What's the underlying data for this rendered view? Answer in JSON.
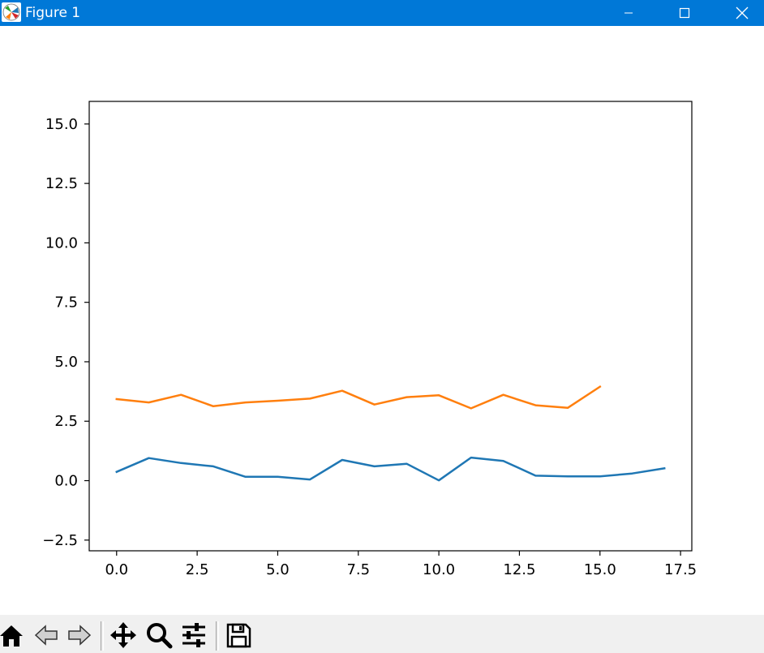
{
  "window": {
    "title": "Figure 1",
    "icon": "matplotlib-figure-icon",
    "controls": [
      "minimize-icon",
      "maximize-icon",
      "close-icon"
    ]
  },
  "toolbar": {
    "tools": [
      {
        "name": "home-button",
        "icon": "home-icon"
      },
      {
        "name": "back-button",
        "icon": "back-arrow-icon"
      },
      {
        "name": "forward-button",
        "icon": "forward-arrow-icon"
      },
      {
        "name": "pan-button",
        "icon": "move-icon"
      },
      {
        "name": "zoom-button",
        "icon": "zoom-icon"
      },
      {
        "name": "configure-subplots-button",
        "icon": "sliders-icon"
      },
      {
        "name": "save-button",
        "icon": "save-icon"
      }
    ]
  },
  "chart_data": {
    "type": "line",
    "title": "",
    "xlabel": "",
    "ylabel": "",
    "xlim": [
      -0.85,
      17.85
    ],
    "ylim": [
      -2.95,
      15.95
    ],
    "xticks": [
      "0.0",
      "2.5",
      "5.0",
      "7.5",
      "10.0",
      "12.5",
      "15.0",
      "17.5"
    ],
    "xtick_values": [
      0,
      2.5,
      5,
      7.5,
      10,
      12.5,
      15,
      17.5
    ],
    "yticks": [
      "−2.5",
      "0.0",
      "2.5",
      "5.0",
      "7.5",
      "10.0",
      "12.5",
      "15.0"
    ],
    "ytick_values": [
      -2.5,
      0,
      2.5,
      5,
      7.5,
      10,
      12.5,
      15
    ],
    "grid": false,
    "series": [
      {
        "color": "#1f77b4",
        "x": [
          0,
          1,
          2,
          3,
          4,
          5,
          6,
          7,
          8,
          9,
          10,
          11,
          12,
          13,
          14,
          15,
          16,
          17
        ],
        "y": [
          0.37,
          0.95,
          0.74,
          0.6,
          0.16,
          0.16,
          0.05,
          0.87,
          0.6,
          0.71,
          0.01,
          0.97,
          0.83,
          0.21,
          0.18,
          0.18,
          0.3,
          0.52
        ]
      },
      {
        "color": "#ff7f0e",
        "x": [
          0,
          1,
          2,
          3,
          4,
          5,
          6,
          7,
          8,
          9,
          10,
          11,
          12,
          13,
          14,
          15
        ],
        "y": [
          3.43,
          3.29,
          3.61,
          3.13,
          3.29,
          3.36,
          3.45,
          3.78,
          3.2,
          3.51,
          3.59,
          3.04,
          3.61,
          3.17,
          3.06,
          3.95
        ]
      }
    ]
  }
}
